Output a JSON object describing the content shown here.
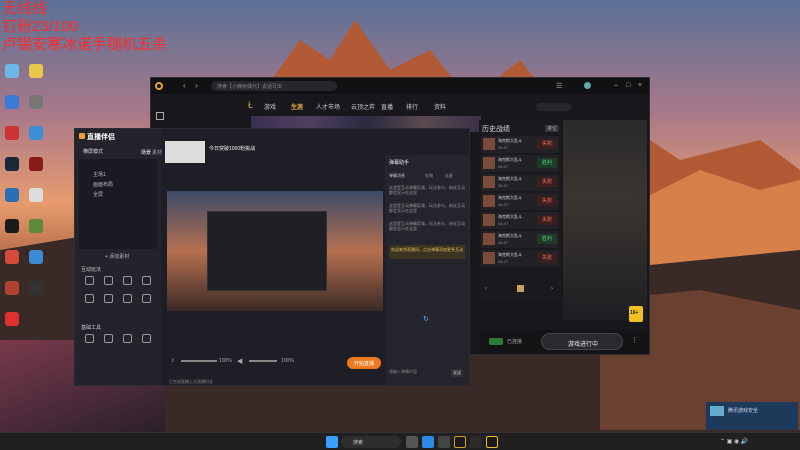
{
  "overlay": {
    "line1": "无线线",
    "line2": "钉粉23/100",
    "line3": "卢锡安寒冰诺手随机五杀"
  },
  "desktop": {
    "icons": [
      {
        "label": "",
        "color": "#6fb6e8"
      },
      {
        "label": "",
        "color": "#e8c84a"
      },
      {
        "label": "",
        "color": "#3a7bd5"
      },
      {
        "label": "",
        "color": "#777"
      },
      {
        "label": "",
        "color": "#cc3333"
      },
      {
        "label": "",
        "color": "#3c8fd6"
      },
      {
        "label": "",
        "color": "#1b2838"
      },
      {
        "label": "",
        "color": "#8a1a1a"
      },
      {
        "label": "",
        "color": "#2a6fb5"
      },
      {
        "label": "",
        "color": "#dddddd"
      },
      {
        "label": "",
        "color": "#1a1a1a"
      },
      {
        "label": "",
        "color": "#5a8a3a"
      },
      {
        "label": "",
        "color": "#d64a3a"
      },
      {
        "label": "",
        "color": "#3a8ad6"
      },
      {
        "label": "",
        "color": "#b0432e"
      },
      {
        "label": "",
        "color": "#333"
      },
      {
        "label": "",
        "color": "#e03030"
      }
    ]
  },
  "client": {
    "search_placeholder": "搜索【小鹿射偶元】说话写出",
    "nav": [
      "游戏",
      "生涯",
      "人才市场",
      "云顶之弈",
      "直播",
      "排行",
      "资料"
    ],
    "history_title": "历史战绩",
    "history_tag": "排位",
    "match_mode": "海克斯大乱斗",
    "match_date": "08-07",
    "results": [
      "失败",
      "胜利",
      "失败",
      "失败",
      "失败",
      "胜利",
      "失败"
    ],
    "footer_status": "已连接",
    "start_button": "游戏进行中",
    "age_badge": "16+"
  },
  "obs": {
    "title": "直播伴侣",
    "mode": "横屏模式",
    "tabs": [
      "场景",
      "素材"
    ],
    "scene_items": [
      "主场1",
      "画面布局",
      "全屏"
    ],
    "add_scene": "+ 添加素材",
    "section_interaction": "互动玩法",
    "section_tools": "基础工具",
    "stream_title": "今日突破1000粉挑战",
    "volume1": "100%",
    "volume2": "100%",
    "start_live": "开始直播",
    "stats_left": "已完成直播上次直播时长",
    "chat_title": "弹幕助手",
    "chat_tabs": [
      "弹幕消息",
      "礼物",
      "连麦"
    ],
    "chat_messages": [
      "这里是互动弹幕区域，玩法参与、粉丝互动都会显示在这里",
      "这里是互动弹幕区域，玩法参与、粉丝互动都会显示在这里",
      "这里是互动弹幕区域，玩法参与、粉丝互动都会显示在这里"
    ],
    "chat_highlight": "欢迎来到直播间，点击弹幕添加更多互动",
    "chat_input": "请输入弹幕内容",
    "chat_send": "发送"
  },
  "taskbar": {
    "search": "搜索",
    "notify_text": "腾讯游戏安全"
  }
}
